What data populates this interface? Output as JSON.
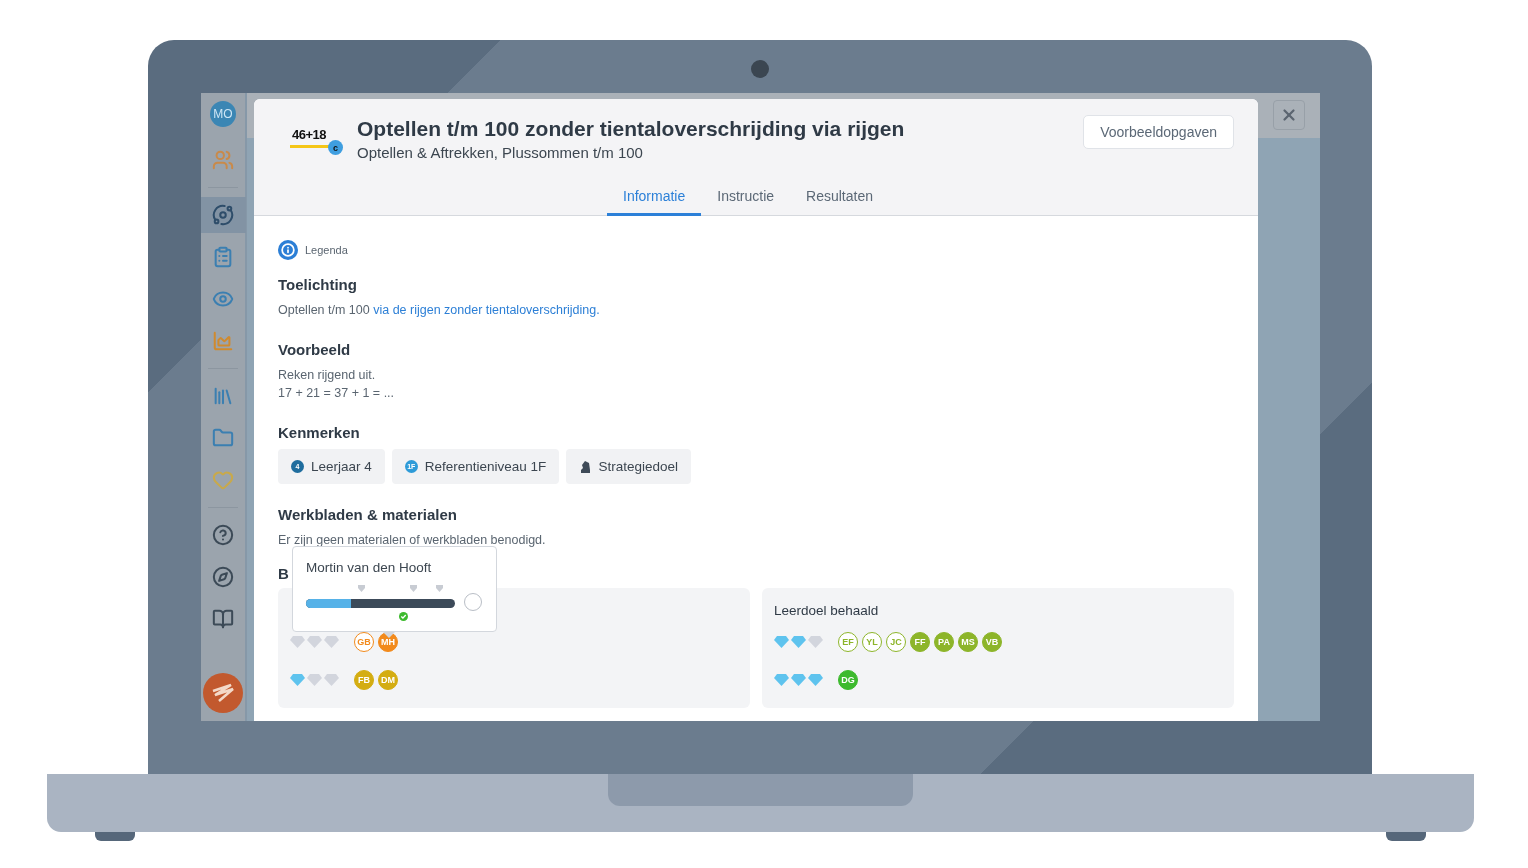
{
  "sidebar": {
    "avatar": "MO",
    "groups": [
      {
        "items": [
          {
            "selected": false
          }
        ]
      },
      {
        "items": [
          {
            "selected": true
          },
          {
            "selected": false
          },
          {
            "selected": false
          },
          {
            "selected": false
          }
        ]
      },
      {
        "items": [
          {
            "selected": false
          },
          {
            "selected": false
          },
          {
            "selected": false
          }
        ]
      },
      {
        "items": [
          {
            "selected": false
          },
          {
            "selected": false
          },
          {
            "selected": false
          }
        ]
      }
    ]
  },
  "modal": {
    "logo": {
      "text": "46+18",
      "badge": "c"
    },
    "title": "Optellen t/m 100 zonder tientaloverschrijding via rijgen",
    "subtitle": "Optellen & Aftrekken, Plussommen t/m 100",
    "button": "Voorbeeldopgaven",
    "tabs": [
      {
        "label": "Informatie",
        "selected": true
      },
      {
        "label": "Instructie",
        "selected": false
      },
      {
        "label": "Resultaten",
        "selected": false
      }
    ],
    "legend": "Legenda",
    "sections": [
      {
        "kind": "text",
        "heading": "Toelichting",
        "lines": [
          {
            "text": "Optellen t/m 100 ",
            "link": "via de rijgen zonder tientaloverschrijding."
          }
        ]
      },
      {
        "kind": "text",
        "heading": "Voorbeeld",
        "lines": [
          {
            "text": "Reken rijgend uit."
          },
          {
            "text": "17 + 21 = 37 + 1 = ..."
          }
        ]
      },
      {
        "kind": "chips",
        "heading": "Kenmerken",
        "chips": [
          {
            "kind": "number",
            "badge": "4",
            "label": "Leerjaar 4",
            "color": "#1f6d9e"
          },
          {
            "kind": "number",
            "badge": "1F",
            "label": "Referentieniveau 1F",
            "color": "#2d9bd8"
          },
          {
            "kind": "icon",
            "label": "Strategiedoel",
            "color": "#3e4a57"
          }
        ]
      },
      {
        "kind": "text",
        "heading": "Werkbladen & materialen",
        "lines": [
          {
            "text": "Er zijn geen materialen of werkbladen benodigd."
          }
        ]
      }
    ],
    "results": {
      "heading": "B",
      "cards": [
        {
          "rows": [
            {
              "stars": 0,
              "students": [
                {
                  "initials": "GB",
                  "solid": false,
                  "color": "#f28a1c"
                },
                {
                  "initials": "MH",
                  "solid": true,
                  "color": "#f28a1c"
                }
              ]
            },
            {
              "stars": 1,
              "students": [
                {
                  "initials": "FB",
                  "solid": true,
                  "color": "#d4ad12"
                },
                {
                  "initials": "DM",
                  "solid": true,
                  "color": "#d4ad12"
                }
              ]
            }
          ]
        },
        {
          "title": "Leerdoel behaald",
          "rows": [
            {
              "stars": 2,
              "students": [
                {
                  "initials": "EF",
                  "solid": false,
                  "color": "#8db52a"
                },
                {
                  "initials": "YL",
                  "solid": false,
                  "color": "#8db52a"
                },
                {
                  "initials": "JC",
                  "solid": false,
                  "color": "#8db52a"
                },
                {
                  "initials": "FF",
                  "solid": true,
                  "color": "#8db52a"
                },
                {
                  "initials": "PA",
                  "solid": true,
                  "color": "#8db52a"
                },
                {
                  "initials": "MS",
                  "solid": true,
                  "color": "#8db52a"
                },
                {
                  "initials": "VB",
                  "solid": true,
                  "color": "#8db52a"
                }
              ]
            },
            {
              "stars": 3,
              "students": [
                {
                  "initials": "DG",
                  "solid": true,
                  "color": "#3dba2e"
                }
              ]
            }
          ]
        }
      ]
    },
    "popup": {
      "name": "Mortin van den Hooft",
      "level": 0.3
    }
  }
}
